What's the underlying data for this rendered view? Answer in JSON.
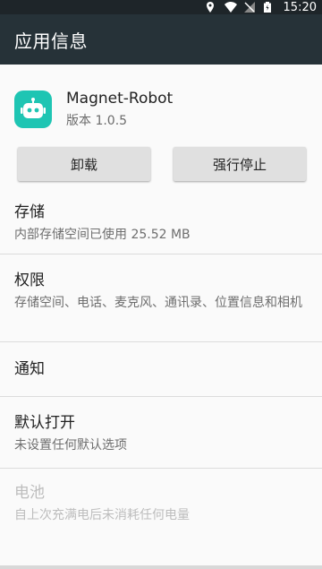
{
  "status_bar": {
    "time": "15:20",
    "icons": [
      "location-icon",
      "wifi-icon",
      "signal-icon",
      "battery-icon"
    ]
  },
  "app_bar": {
    "title": "应用信息"
  },
  "app": {
    "name": "Magnet-Robot",
    "version": "版本 1.0.5",
    "icon": "robot-icon",
    "icon_color": "#1ec5b3"
  },
  "buttons": {
    "uninstall": "卸载",
    "force_stop": "强行停止"
  },
  "sections": {
    "storage": {
      "title": "存储",
      "subtitle": "内部存储空间已使用 25.52 MB"
    },
    "permissions": {
      "title": "权限",
      "subtitle": "存储空间、电话、麦克风、通讯录、位置信息和相机"
    },
    "notifications": {
      "title": "通知"
    },
    "default_open": {
      "title": "默认打开",
      "subtitle": "未设置任何默认选项"
    },
    "battery": {
      "title": "电池",
      "subtitle": "自上次充满电后未消耗任何电量",
      "disabled": true
    }
  },
  "colors": {
    "app_bar": "#263238",
    "status_bar": "#1e2529",
    "background": "#fafafa",
    "button": "#e0e0e0"
  }
}
